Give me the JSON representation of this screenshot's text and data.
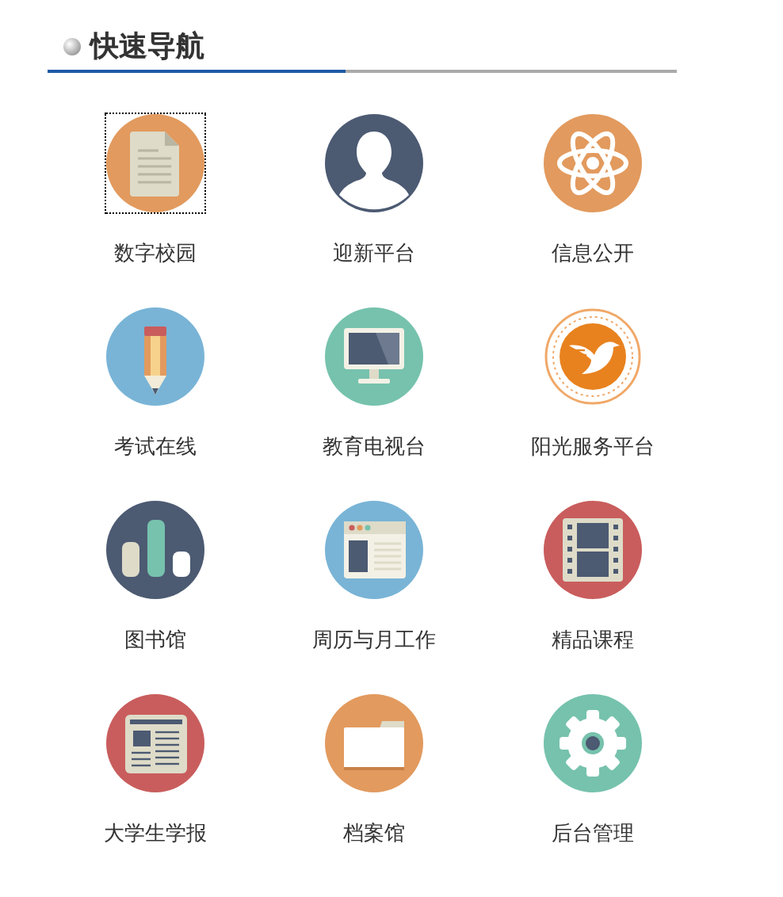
{
  "header": {
    "title": "快速导航"
  },
  "items": [
    {
      "kind": "document",
      "label": "数字校园",
      "focused": true
    },
    {
      "kind": "person",
      "label": "迎新平台",
      "focused": false
    },
    {
      "kind": "atom",
      "label": "信息公开",
      "focused": false
    },
    {
      "kind": "pencil",
      "label": "考试在线",
      "focused": false
    },
    {
      "kind": "monitor",
      "label": "教育电视台",
      "focused": false
    },
    {
      "kind": "emblem",
      "label": "阳光服务平台",
      "focused": false
    },
    {
      "kind": "chart",
      "label": "图书馆",
      "focused": false
    },
    {
      "kind": "browser",
      "label": "周历与月工作",
      "focused": false
    },
    {
      "kind": "film",
      "label": "精品课程",
      "focused": false
    },
    {
      "kind": "newspaper",
      "label": "大学生学报",
      "focused": false
    },
    {
      "kind": "folder",
      "label": "档案馆",
      "focused": false
    },
    {
      "kind": "gear",
      "label": "后台管理",
      "focused": false
    }
  ]
}
